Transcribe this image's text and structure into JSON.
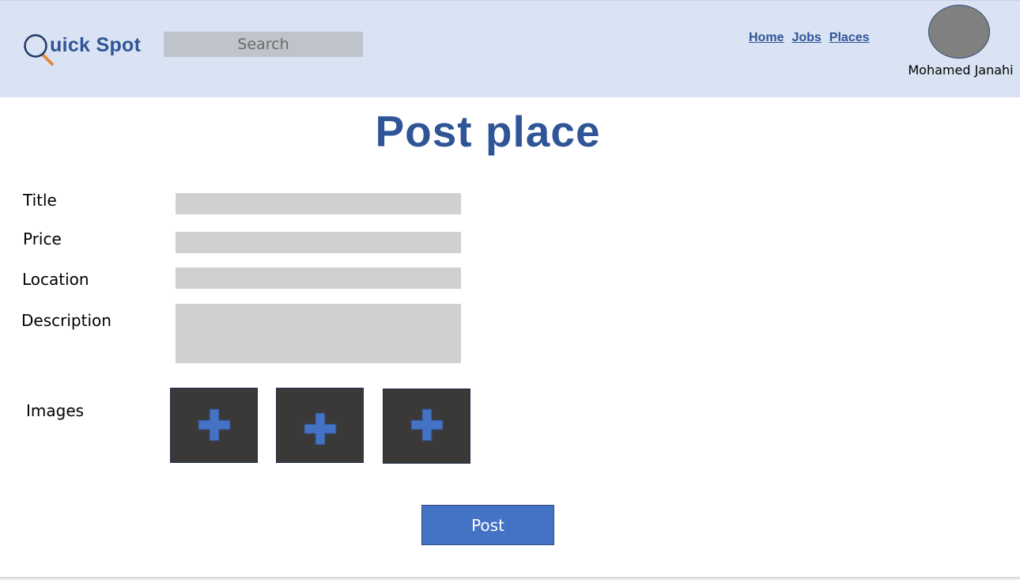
{
  "header": {
    "logo_text": "uick Spot",
    "logo_icon": "magnifier-icon",
    "search_placeholder": "Search",
    "nav": {
      "home": "Home",
      "jobs": "Jobs",
      "places": "Places"
    },
    "user_name": "Mohamed Janahi"
  },
  "main": {
    "title": "Post place",
    "fields": {
      "title_label": "Title",
      "price_label": "Price",
      "location_label": "Location",
      "description_label": "Description",
      "images_label": "Images"
    },
    "image_slot_icon": "plus-icon",
    "post_button": "Post"
  },
  "colors": {
    "header_bg": "#dae3f3",
    "brand": "#2f5597",
    "accent": "#4472c4",
    "input_bg": "#d0d0d0",
    "image_slot_bg": "#3b3838",
    "avatar": "#808080"
  }
}
